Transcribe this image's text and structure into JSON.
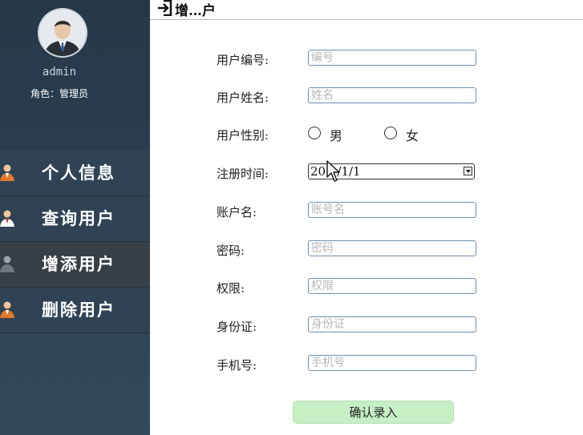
{
  "sidebar": {
    "user_name": "admin",
    "role_label": "角色：管理员",
    "nav_items": [
      {
        "label": "个人信息",
        "icon": "person-icon",
        "active": false
      },
      {
        "label": "查询用户",
        "icon": "person-icon",
        "active": false
      },
      {
        "label": "增添用户",
        "icon": "person-icon",
        "active": true
      },
      {
        "label": "删除用户",
        "icon": "person-icon",
        "active": false
      }
    ]
  },
  "header": {
    "title": "增…户",
    "icon": "enter-icon"
  },
  "form": {
    "user_id": {
      "label": "用户编号:",
      "placeholder": "编号"
    },
    "user_name": {
      "label": "用户姓名:",
      "placeholder": "姓名"
    },
    "gender": {
      "label": "用户性别:",
      "options": [
        "男",
        "女"
      ]
    },
    "reg_date": {
      "label": "注册时间:",
      "value": "20   /1/1"
    },
    "account": {
      "label": "账户名:",
      "placeholder": "账号名"
    },
    "password": {
      "label": "密码:",
      "placeholder": "密码"
    },
    "permission": {
      "label": "权限:",
      "placeholder": "权限"
    },
    "id_card": {
      "label": "身份证:",
      "placeholder": "身份证"
    },
    "phone": {
      "label": "手机号:",
      "placeholder": "手机号"
    },
    "submit_label": "确认录入"
  },
  "colors": {
    "sidebar_bg": "#2b3f52",
    "active_item_bg": "#373f46",
    "submit_bg": "#c7efc4",
    "input_border": "#6f8fb0"
  }
}
